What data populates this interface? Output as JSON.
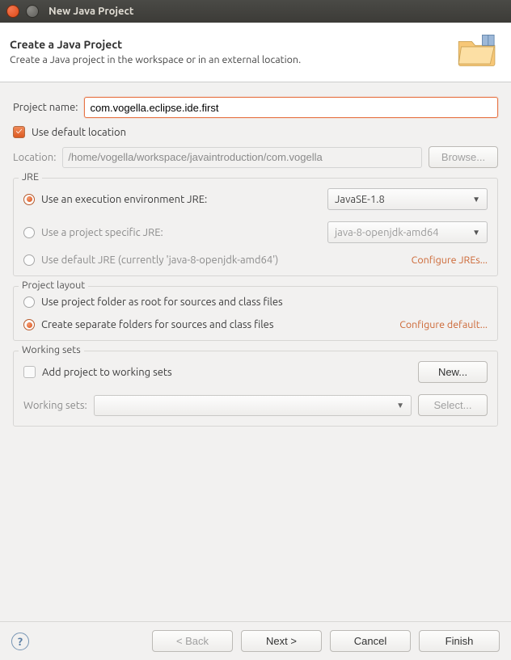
{
  "window": {
    "title": "New Java Project"
  },
  "banner": {
    "heading": "Create a Java Project",
    "subheading": "Create a Java project in the workspace or in an external location."
  },
  "project": {
    "name_label": "Project name:",
    "name_value": "com.vogella.eclipse.ide.first",
    "use_default_label": "Use default location",
    "location_label": "Location:",
    "location_value": "/home/vogella/workspace/javaintroduction/com.vogella",
    "browse_label": "Browse..."
  },
  "jre": {
    "legend": "JRE",
    "opt_exec_env": "Use an execution environment JRE:",
    "exec_env_value": "JavaSE-1.8",
    "opt_specific": "Use a project specific JRE:",
    "specific_value": "java-8-openjdk-amd64",
    "opt_default": "Use default JRE (currently 'java-8-openjdk-amd64')",
    "configure_link": "Configure JREs..."
  },
  "layout": {
    "legend": "Project layout",
    "opt_root": "Use project folder as root for sources and class files",
    "opt_separate": "Create separate folders for sources and class files",
    "configure_link": "Configure default..."
  },
  "working_sets": {
    "legend": "Working sets",
    "add_label": "Add project to working sets",
    "new_btn": "New...",
    "sets_label": "Working sets:",
    "select_btn": "Select..."
  },
  "footer": {
    "back": "< Back",
    "next": "Next >",
    "cancel": "Cancel",
    "finish": "Finish"
  }
}
